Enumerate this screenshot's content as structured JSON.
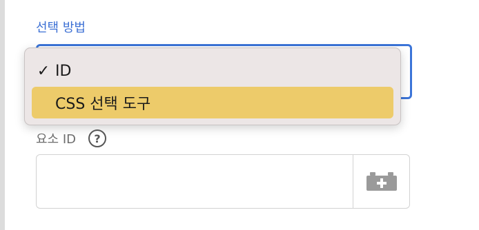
{
  "form": {
    "selection_method_label": "선택 방법",
    "element_id_label": "요소 ID",
    "help_glyph": "?",
    "element_id_value": "",
    "picker_icon": "lego-brick-add-icon"
  },
  "dropdown": {
    "selected": "ID",
    "options": [
      {
        "label": "ID",
        "checked": true,
        "check_glyph": "✓"
      },
      {
        "label": "CSS 선택 도구",
        "checked": false,
        "highlighted": true
      }
    ]
  },
  "colors": {
    "accent": "#3b74d8",
    "highlight": "#edcb6a",
    "menu_bg": "#ece6e6"
  }
}
